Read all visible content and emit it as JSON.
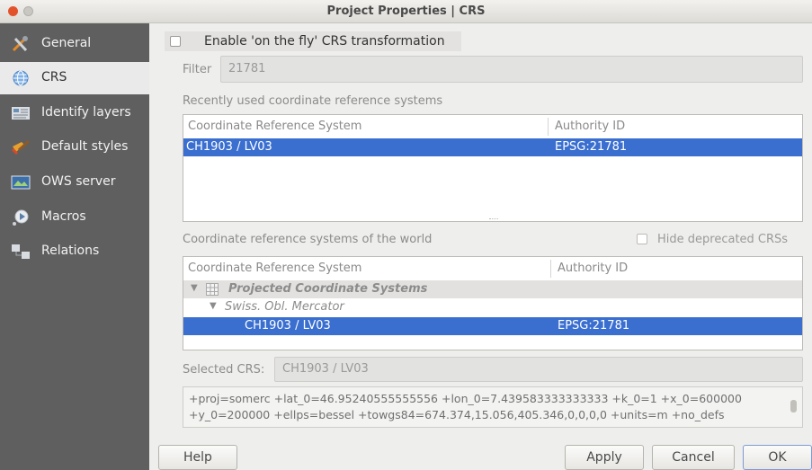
{
  "window": {
    "title": "Project Properties | CRS"
  },
  "sidebar": {
    "items": [
      {
        "label": "General",
        "icon": "tools-icon",
        "active": false
      },
      {
        "label": "CRS",
        "icon": "globe-icon",
        "active": true
      },
      {
        "label": "Identify layers",
        "icon": "identify-icon",
        "active": false
      },
      {
        "label": "Default styles",
        "icon": "paint-brush-icon",
        "active": false
      },
      {
        "label": "OWS server",
        "icon": "ows-server-icon",
        "active": false
      },
      {
        "label": "Macros",
        "icon": "macros-icon",
        "active": false
      },
      {
        "label": "Relations",
        "icon": "relations-icon",
        "active": false
      }
    ]
  },
  "crs": {
    "enable_otf_label": "Enable 'on the fly' CRS transformation",
    "enable_otf_checked": false,
    "filter_label": "Filter",
    "filter_value": "21781",
    "recent_label": "Recently used coordinate reference systems",
    "recent_headers": {
      "crs": "Coordinate Reference System",
      "authority": "Authority ID"
    },
    "recent_rows": [
      {
        "crs": "CH1903 / LV03",
        "authority": "EPSG:21781"
      }
    ],
    "world_label": "Coordinate reference systems of the world",
    "hide_deprecated_label": "Hide deprecated CRSs",
    "hide_deprecated_checked": false,
    "world_headers": {
      "crs": "Coordinate Reference System",
      "authority": "Authority ID"
    },
    "world_tree": {
      "group": "Projected Coordinate Systems",
      "subgroup": "Swiss. Obl. Mercator",
      "item": {
        "crs": "CH1903 / LV03",
        "authority": "EPSG:21781"
      }
    },
    "selected_label": "Selected CRS:",
    "selected_value": "CH1903 / LV03",
    "proj_line1": "+proj=somerc +lat_0=46.95240555555556 +lon_0=7.439583333333333 +k_0=1 +x_0=600000",
    "proj_line2": "+y_0=200000 +ellps=bessel +towgs84=674.374,15.056,405.346,0,0,0,0 +units=m +no_defs"
  },
  "buttons": {
    "help": "Help",
    "apply": "Apply",
    "cancel": "Cancel",
    "ok": "OK"
  },
  "colors": {
    "selection": "#3a6fd0",
    "sidebar_bg": "#5f5f5f"
  }
}
